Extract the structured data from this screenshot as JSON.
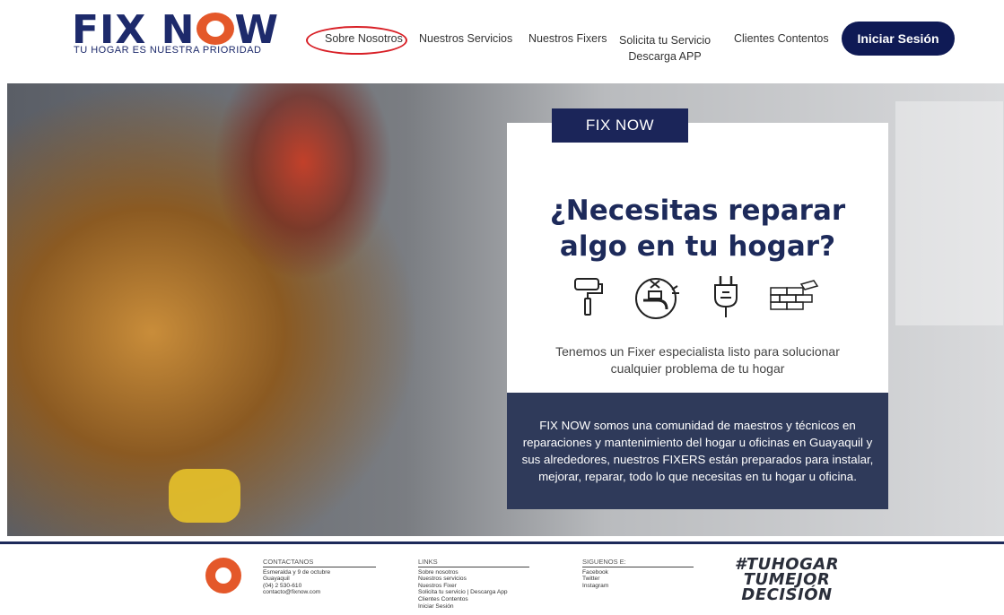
{
  "brand": {
    "logo_text_pre": "FIX N",
    "logo_text_post": "W",
    "tagline": "TU HOGAR ES NUESTRA PRIORIDAD",
    "accent_color": "#e4582a",
    "primary_color": "#1d2a6b"
  },
  "nav": {
    "items": [
      {
        "label": "Sobre Nosotros"
      },
      {
        "label": "Nuestros Servicios"
      },
      {
        "label": "Nuestros Fixers"
      },
      {
        "label": "Solicita tu Servicio",
        "sub": "Descarga APP"
      },
      {
        "label": "Clientes Contentos"
      }
    ],
    "login_label": "Iniciar Sesión"
  },
  "hero": {
    "tag": "FIX NOW",
    "title_line1": "¿Necesitas reparar",
    "title_line2": "algo en tu hogar?",
    "icons": [
      "paint-roller-icon",
      "faucet-icon",
      "plug-icon",
      "bricks-icon"
    ],
    "subtitle_line1": "Tenemos un Fixer especialista listo para solucionar",
    "subtitle_line2": "cualquier problema de tu hogar",
    "description": "FIX NOW somos una comunidad de maestros y técnicos en reparaciones y mantenimiento del hogar u oficinas en Guayaquil y sus alrededores, nuestros FIXERS están preparados para instalar, mejorar, reparar, todo lo que necesitas en tu hogar u oficina."
  },
  "footer": {
    "contact": {
      "heading": "CONTACTANOS",
      "lines": [
        "Esmeralda y 9 de octubre",
        "Guayaquil",
        "(04) 2 530-610",
        "contacto@fixnow.com"
      ]
    },
    "links": {
      "heading": "LINKS",
      "items": [
        "Sobre nosotros",
        "Nuestros servicios",
        "Nuestros Fixer",
        "Solicita tu servicio | Descarga App",
        "Clientes Contentos",
        "Iniciar Sesión"
      ]
    },
    "social": {
      "heading": "SIGUENOS E:",
      "items": [
        "Facebook",
        "Twitter",
        "Instagram"
      ]
    },
    "hashtag_line1": "#TUHOGAR",
    "hashtag_line2": "TUMEJOR",
    "hashtag_line3": "DECISIÓN"
  }
}
